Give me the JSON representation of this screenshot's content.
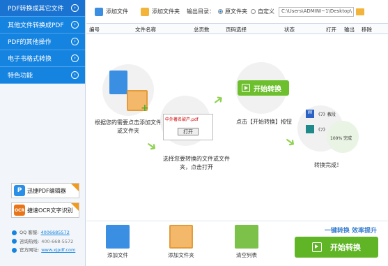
{
  "sidebar": {
    "items": [
      {
        "label": "PDF转换成其它文件"
      },
      {
        "label": "其他文件转换成PDF"
      },
      {
        "label": "PDF的其他操作"
      },
      {
        "label": "电子书格式转换"
      },
      {
        "label": "特色功能"
      }
    ],
    "promos": [
      {
        "label": "迅捷PDF编辑器"
      },
      {
        "label": "捷速OCR文字识别"
      }
    ],
    "contact": {
      "qq_label": "QQ 客服:",
      "qq_value": "4006685572",
      "phone_label": "咨询热线:",
      "phone_value": "400-668-5572",
      "site_label": "官方网址:",
      "site_value": "www.xjpdf.com"
    }
  },
  "toolbar": {
    "add_file": "添加文件",
    "add_folder": "添加文件夹",
    "output_label": "输出目录：",
    "radio_original": "原文件夹",
    "radio_custom": "自定义",
    "path": "C:\\Users\\ADMINI~1\\Desktop\\"
  },
  "table": {
    "columns": [
      "编号",
      "文件名称",
      "总页数",
      "页码选择",
      "状态",
      "打开",
      "输出",
      "移除"
    ]
  },
  "guide": {
    "step1": "根据您的需要点击添加文件或文件夹",
    "step2": "选择您要转换的文件或文件夹，点击打开",
    "step3": "点击【开始转换】按钮",
    "step4": "转换完成！",
    "start_label": "开始转换",
    "dialog_file": "中外著名破产.pdf",
    "dialog_open": "打开",
    "result_a": "《7》教段",
    "result_b": "《7》",
    "percent": "100%",
    "done": "完成"
  },
  "bottom": {
    "add_file": "添加文件",
    "add_folder": "添加文件夹",
    "clear": "清空列表",
    "slogan": "一键转换  效率提升",
    "start": "开始转换"
  },
  "colors": {
    "nav_blue": "#1583e0",
    "start_green": "#5fb526"
  }
}
